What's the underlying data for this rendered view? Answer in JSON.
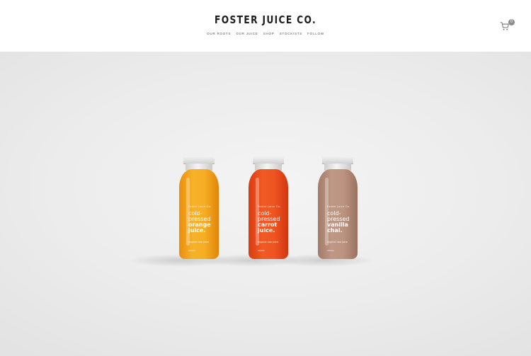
{
  "header": {
    "brand": "FOSTER JUICE CO.",
    "nav": [
      "OUR ROOTS",
      "OUR JUICE",
      "SHOP",
      "STOCKISTS",
      "FOLLOW"
    ],
    "cart_count": "0",
    "cart_icon": "cart-icon"
  },
  "bottles": [
    {
      "top_label": "Foster Juice Co.",
      "cold": "cold-",
      "pressed": "pressed",
      "flavor1": "orange",
      "flavor2": "juice.",
      "organic": "organic raw juice",
      "volume": "250ml",
      "color": "#f3a11a"
    },
    {
      "top_label": "Foster Juice Co.",
      "cold": "cold-",
      "pressed": "pressed",
      "flavor1": "carrot",
      "flavor2": "juice.",
      "organic": "organic raw juice",
      "volume": "250ml",
      "color": "#ea4a1a"
    },
    {
      "top_label": "Foster Juice Co.",
      "cold": "cold-",
      "pressed": "pressed",
      "flavor1": "vanilla",
      "flavor2": "chai.",
      "organic": "organic raw juice",
      "volume": "250ml",
      "color": "#b38b78"
    }
  ]
}
